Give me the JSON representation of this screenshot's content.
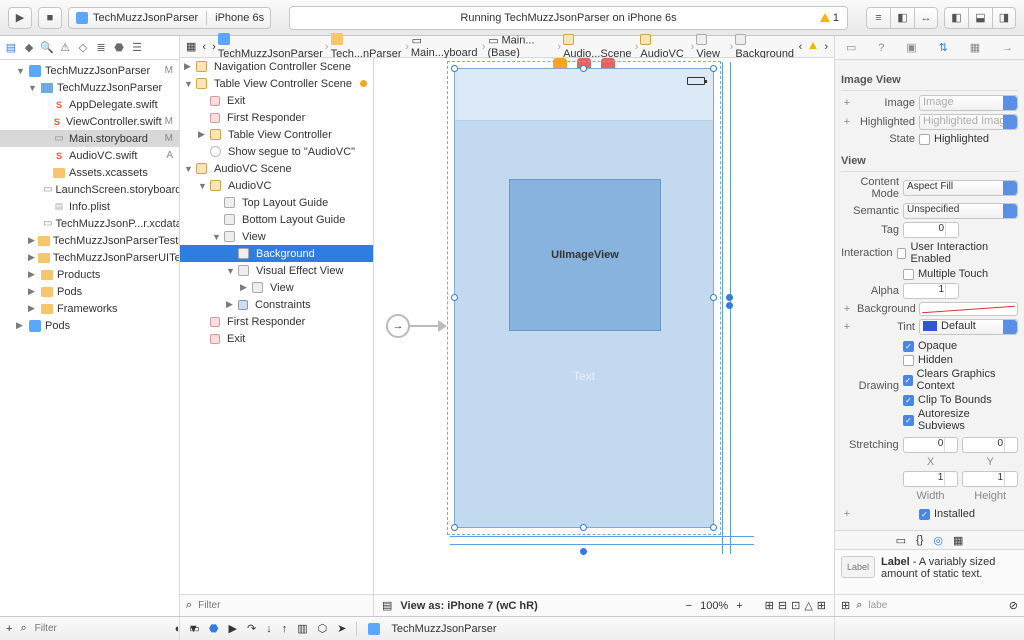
{
  "toolbar": {
    "scheme_project": "TechMuzzJsonParser",
    "scheme_device": "iPhone 6s",
    "status_text": "Running TechMuzzJsonParser on iPhone 6s",
    "warning_count": "1"
  },
  "nav": {
    "items": [
      {
        "d": 1,
        "disc": "▼",
        "ico": "proj",
        "label": "TechMuzzJsonParser",
        "stat": "M"
      },
      {
        "d": 2,
        "disc": "▼",
        "ico": "fold-b",
        "label": "TechMuzzJsonParser",
        "stat": ""
      },
      {
        "d": 3,
        "disc": "",
        "ico": "swift",
        "label": "AppDelegate.swift",
        "stat": ""
      },
      {
        "d": 3,
        "disc": "",
        "ico": "swift",
        "label": "ViewController.swift",
        "stat": "M"
      },
      {
        "d": 3,
        "disc": "",
        "ico": "sb",
        "label": "Main.storyboard",
        "stat": "M",
        "sel": true
      },
      {
        "d": 3,
        "disc": "",
        "ico": "swift",
        "label": "AudioVC.swift",
        "stat": "A"
      },
      {
        "d": 3,
        "disc": "",
        "ico": "fold",
        "label": "Assets.xcassets",
        "stat": ""
      },
      {
        "d": 3,
        "disc": "",
        "ico": "sb",
        "label": "LaunchScreen.storyboard",
        "stat": ""
      },
      {
        "d": 3,
        "disc": "",
        "ico": "plist",
        "label": "Info.plist",
        "stat": ""
      },
      {
        "d": 3,
        "disc": "",
        "ico": "sb",
        "label": "TechMuzzJsonP...r.xcdatamodeld",
        "stat": ""
      },
      {
        "d": 2,
        "disc": "▶",
        "ico": "fold",
        "label": "TechMuzzJsonParserTests",
        "stat": ""
      },
      {
        "d": 2,
        "disc": "▶",
        "ico": "fold",
        "label": "TechMuzzJsonParserUITests",
        "stat": ""
      },
      {
        "d": 2,
        "disc": "▶",
        "ico": "fold",
        "label": "Products",
        "stat": ""
      },
      {
        "d": 2,
        "disc": "▶",
        "ico": "fold",
        "label": "Pods",
        "stat": ""
      },
      {
        "d": 2,
        "disc": "▶",
        "ico": "fold",
        "label": "Frameworks",
        "stat": ""
      },
      {
        "d": 1,
        "disc": "▶",
        "ico": "proj",
        "label": "Pods",
        "stat": ""
      }
    ],
    "filter_placeholder": "Filter"
  },
  "jump": {
    "items": [
      "TechMuzzJsonParser",
      "Tech...nParser",
      "Main...yboard",
      "Main...(Base)",
      "Audio...Scene",
      "AudioVC",
      "View",
      "Background"
    ]
  },
  "outline": {
    "items": [
      {
        "d": 0,
        "disc": "▶",
        "ico": "sq-o",
        "label": "Navigation Controller Scene"
      },
      {
        "d": 0,
        "disc": "▼",
        "ico": "sq-o",
        "label": "Table View Controller Scene",
        "dot": true
      },
      {
        "d": 1,
        "disc": "",
        "ico": "sq-r",
        "label": "Exit"
      },
      {
        "d": 1,
        "disc": "",
        "ico": "sq-r",
        "label": "First Responder"
      },
      {
        "d": 1,
        "disc": "▶",
        "ico": "sq-o",
        "label": "Table View Controller"
      },
      {
        "d": 1,
        "disc": "",
        "ico": "circ",
        "label": "Show segue to \"AudioVC\""
      },
      {
        "d": 0,
        "disc": "▼",
        "ico": "sq-o",
        "label": "AudioVC Scene"
      },
      {
        "d": 1,
        "disc": "▼",
        "ico": "sq-o",
        "label": "AudioVC"
      },
      {
        "d": 2,
        "disc": "",
        "ico": "sq-g",
        "label": "Top Layout Guide"
      },
      {
        "d": 2,
        "disc": "",
        "ico": "sq-g",
        "label": "Bottom Layout Guide"
      },
      {
        "d": 2,
        "disc": "▼",
        "ico": "sq-g",
        "label": "View"
      },
      {
        "d": 3,
        "disc": "",
        "ico": "sq-g",
        "label": "Background",
        "sel": true
      },
      {
        "d": 3,
        "disc": "▼",
        "ico": "sq-g",
        "label": "Visual Effect View"
      },
      {
        "d": 4,
        "disc": "▶",
        "ico": "sq-g",
        "label": "View"
      },
      {
        "d": 3,
        "disc": "▶",
        "ico": "sq-b",
        "label": "Constraints"
      },
      {
        "d": 1,
        "disc": "",
        "ico": "sq-r",
        "label": "First Responder"
      },
      {
        "d": 1,
        "disc": "",
        "ico": "sq-r",
        "label": "Exit"
      }
    ],
    "filter_placeholder": "Filter"
  },
  "canvas": {
    "uiimage_label": "UIImageView",
    "text_label": "Text",
    "view_as": "View as: iPhone 7 (wC hR)",
    "zoom": "100%"
  },
  "inspector": {
    "sect_imageview": "Image View",
    "image_label": "Image",
    "image_ph": "Image",
    "highlighted_label": "Highlighted",
    "highlighted_ph": "Highlighted Image",
    "state_label": "State",
    "state_opt": "Highlighted",
    "sect_view": "View",
    "contentmode_label": "Content Mode",
    "contentmode_val": "Aspect Fill",
    "semantic_label": "Semantic",
    "semantic_val": "Unspecified",
    "tag_label": "Tag",
    "tag_val": "0",
    "interaction_label": "Interaction",
    "interaction_opt1": "User Interaction Enabled",
    "interaction_opt2": "Multiple Touch",
    "alpha_label": "Alpha",
    "alpha_val": "1",
    "background_label": "Background",
    "tint_label": "Tint",
    "tint_val": "Default",
    "drawing_label": "Drawing",
    "drawing_opts": [
      "Opaque",
      "Hidden",
      "Clears Graphics Context",
      "Clip To Bounds",
      "Autoresize Subviews"
    ],
    "drawing_checked": [
      true,
      false,
      true,
      true,
      true
    ],
    "stretching_label": "Stretching",
    "stretch_x": "0",
    "stretch_y": "0",
    "stretch_w": "1",
    "stretch_h": "1",
    "stretch_xl": "X",
    "stretch_yl": "Y",
    "stretch_wl": "Width",
    "stretch_hl": "Height",
    "installed_label": "Installed",
    "lib_title": "Label",
    "lib_desc": " - A variably sized amount of static text.",
    "lib_filter": "labe"
  },
  "debug": {
    "project": "TechMuzzJsonParser"
  }
}
